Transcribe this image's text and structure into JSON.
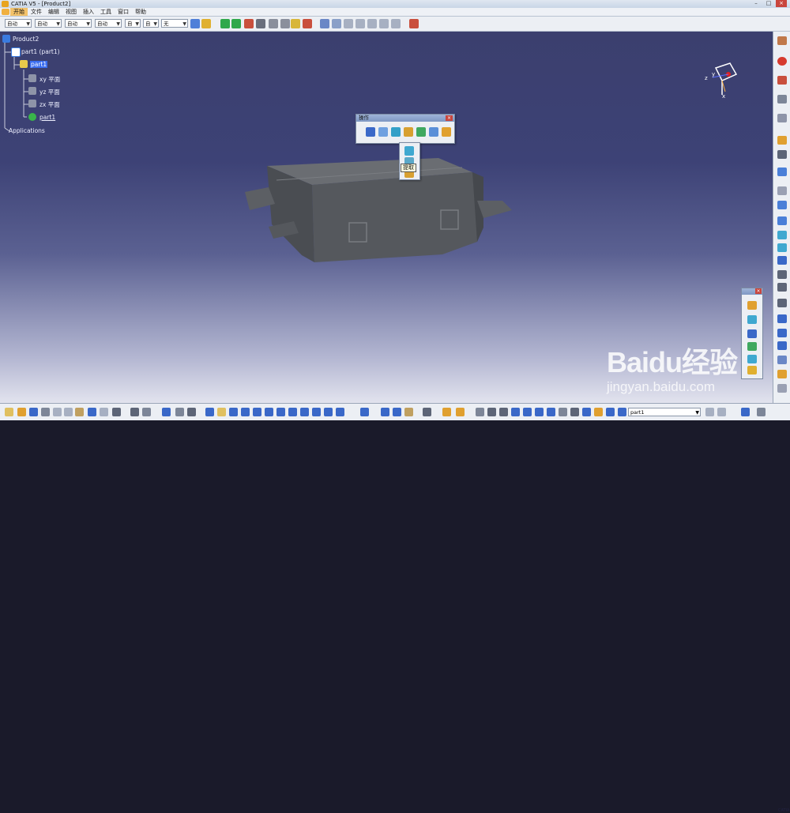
{
  "window": {
    "title": "CATIA V5 - [Product2]",
    "buttons": [
      "–",
      "□",
      "×"
    ]
  },
  "menu": {
    "items": [
      "开始",
      "文件",
      "编辑",
      "视图",
      "插入",
      "工具",
      "窗口",
      "帮助"
    ]
  },
  "toolbar": {
    "combos": [
      "自动",
      "自动",
      "自动",
      "自动",
      "自",
      "自",
      "无"
    ]
  },
  "tree": {
    "root": "Product2",
    "child": "part1 (part1)",
    "part": "part1",
    "planes": [
      "xy 平面",
      "yz 平面",
      "zx 平面"
    ],
    "body": "part1",
    "applications": "Applications"
  },
  "operation_toolbar": {
    "caption": "操作",
    "close": "×"
  },
  "tooltip": {
    "text": "提取"
  },
  "statusbar": {
    "part_combo": "part1"
  },
  "compass_labels": {
    "x": "x",
    "y": "y",
    "z": "z"
  },
  "watermark": {
    "logo": "Baidu经验",
    "url": "jingyan.baidu.com"
  },
  "brand": "CATIA",
  "colors": {
    "background_top": "#3b3f6e",
    "selection": "#3a6df0",
    "model": "#55585c"
  }
}
